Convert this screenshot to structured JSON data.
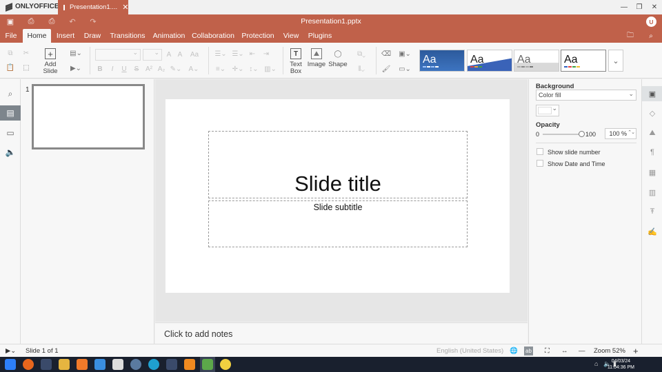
{
  "app": {
    "logo": "ONLYOFFICE",
    "tab_title": "Presentation1....",
    "doc_title": "Presentation1.pptx",
    "user_initial": "U"
  },
  "menu": [
    "File",
    "Home",
    "Insert",
    "Draw",
    "Transitions",
    "Animation",
    "Collaboration",
    "Protection",
    "View",
    "Plugins"
  ],
  "toolbar": {
    "add_slide": [
      "Add",
      "Slide"
    ],
    "text_box": [
      "Text",
      "Box"
    ],
    "image": "Image",
    "shape": "Shape",
    "themes": [
      "Aa",
      "Aa",
      "Aa",
      "Aa"
    ]
  },
  "thumbnails": {
    "slide_number": "1"
  },
  "slide": {
    "title": "Slide title",
    "subtitle": "Slide subtitle"
  },
  "notes": {
    "placeholder": "Click to add notes"
  },
  "right_panel": {
    "background_label": "Background",
    "fill_type": "Color fill",
    "fill_color": "#ffffff",
    "opacity_label": "Opacity",
    "slider_min": "0",
    "slider_max": "100",
    "opacity_value": "100 %",
    "opacity_level": 1.0,
    "show_slide_number": "Show slide number",
    "show_date_time": "Show Date and Time"
  },
  "status": {
    "slide_info": "Slide 1 of 1",
    "language": "English (United States)",
    "zoom": "Zoom 52%"
  },
  "taskbar": {
    "date": "04/03/24",
    "time": "11:04:36 PM"
  },
  "colors": {
    "accent": "#c0614a",
    "active_rail": "#7d858c"
  }
}
